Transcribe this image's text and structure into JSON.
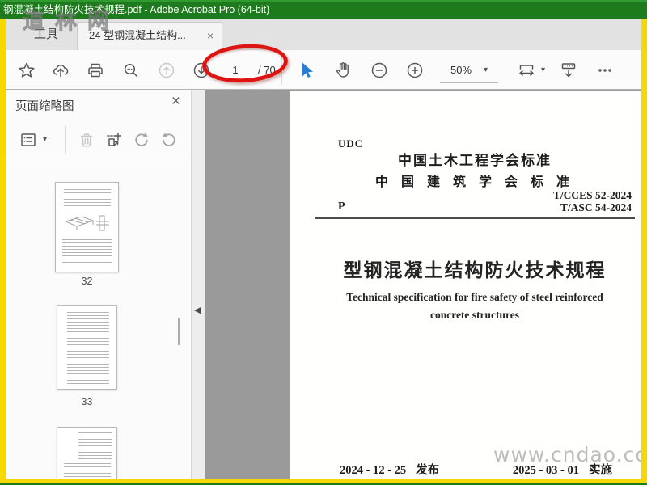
{
  "window": {
    "title": "钢混凝土结构防火技术规程.pdf - Adobe Acrobat Pro (64-bit)"
  },
  "tab_bar": {
    "tools_tab": "工具",
    "document_tab": "24 型钢混凝土结构...",
    "close_icon": "×"
  },
  "toolbar": {
    "page_number": "1",
    "page_total": "/ 70",
    "zoom_value": "50%"
  },
  "sidebar": {
    "panel_title": "页面缩略图",
    "close_icon": "×",
    "thumbnails": [
      {
        "page_label": "32"
      },
      {
        "page_label": "33"
      },
      {
        "page_label": ""
      }
    ]
  },
  "page": {
    "udc": "UDC",
    "org_line1": "中国土木工程学会标准",
    "org_line2": "中 国 建 筑 学 会 标 准",
    "p_mark": "P",
    "code1": "T/CCES 52-2024",
    "code2": "T/ASC 54-2024",
    "title_cn": "型钢混凝土结构防火技术规程",
    "title_en_line1": "Technical specification for fire safety of steel reinforced",
    "title_en_line2": "concrete structures",
    "publish_date": "2024 - 12 - 25",
    "publish_label": "发布",
    "implement_date": "2025 - 03 - 01",
    "implement_label": "实施"
  },
  "watermarks": {
    "title_area": "道林网",
    "page_corner": "www.cndao.com"
  },
  "icons": {
    "caret_down": "▾",
    "collapse_left": "◀"
  },
  "colors": {
    "title_bar_green": "#1d7b1d",
    "frame_yellow": "#f6d802",
    "annotation_red": "#dc1512",
    "pointer_blue": "#2b7cd3",
    "doc_background": "#9a9a9a"
  }
}
